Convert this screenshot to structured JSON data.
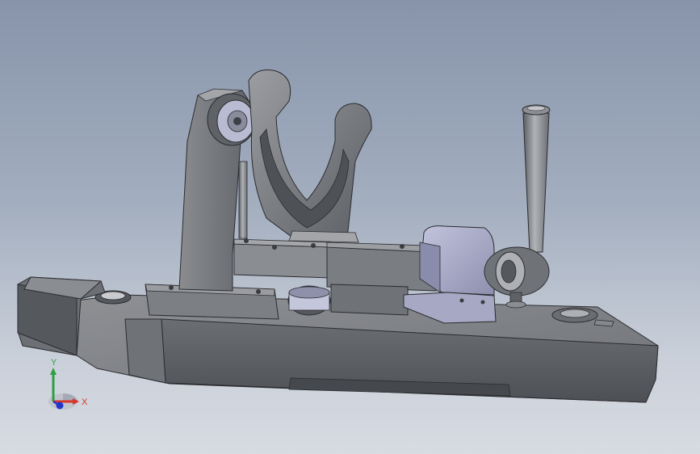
{
  "viewport": {
    "background_top": "#8794aa",
    "background_bottom": "#d7dbe2"
  },
  "model": {
    "parts": [
      "base-plate",
      "side-tab",
      "front-step",
      "support-column",
      "support-block",
      "clevis-roller",
      "v-cradle",
      "guide-pin",
      "slide-bar",
      "slide-block",
      "bearing-ring",
      "clamp-housing",
      "clamp-handle",
      "clamp-eye"
    ],
    "colors": {
      "body_dark": "#5b5e63",
      "body_mid": "#7a7d82",
      "body_light": "#9a9ca0",
      "accent_lavender": "#a9abc8",
      "edge": "#2b2c2f"
    }
  },
  "triad": {
    "y_label": "Y",
    "x_label": "X",
    "y_color": "#2ea043",
    "x_color": "#d9362b",
    "z_color": "#2437c9"
  }
}
